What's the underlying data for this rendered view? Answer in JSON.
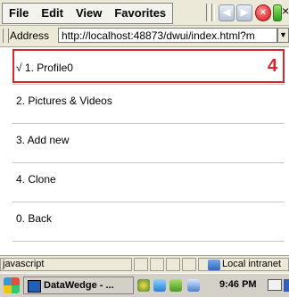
{
  "menu_bar": {
    "items": [
      "File",
      "Edit",
      "View",
      "Favorites"
    ],
    "stop_glyph": "×",
    "close_glyph": "×"
  },
  "address_bar": {
    "label": "Address",
    "url": "http://localhost:48873/dwui/index.html?m",
    "dropdown_glyph": "▼"
  },
  "menu": {
    "selected": {
      "label": "√ 1. Profile0",
      "badge": "4"
    },
    "items": [
      {
        "label": "2. Pictures & Videos"
      },
      {
        "label": "3. Add new"
      },
      {
        "label": "4. Clone"
      },
      {
        "label": "0. Back"
      }
    ]
  },
  "status_bar": {
    "text": "javascript",
    "zone": "Local intranet"
  },
  "taskbar": {
    "app_label": "DataWedge - ...",
    "clock": "9:46 PM"
  },
  "colors": {
    "highlight": "#d9262c",
    "chrome": "#ece9d8",
    "taskbar": "#d4d0c8"
  }
}
